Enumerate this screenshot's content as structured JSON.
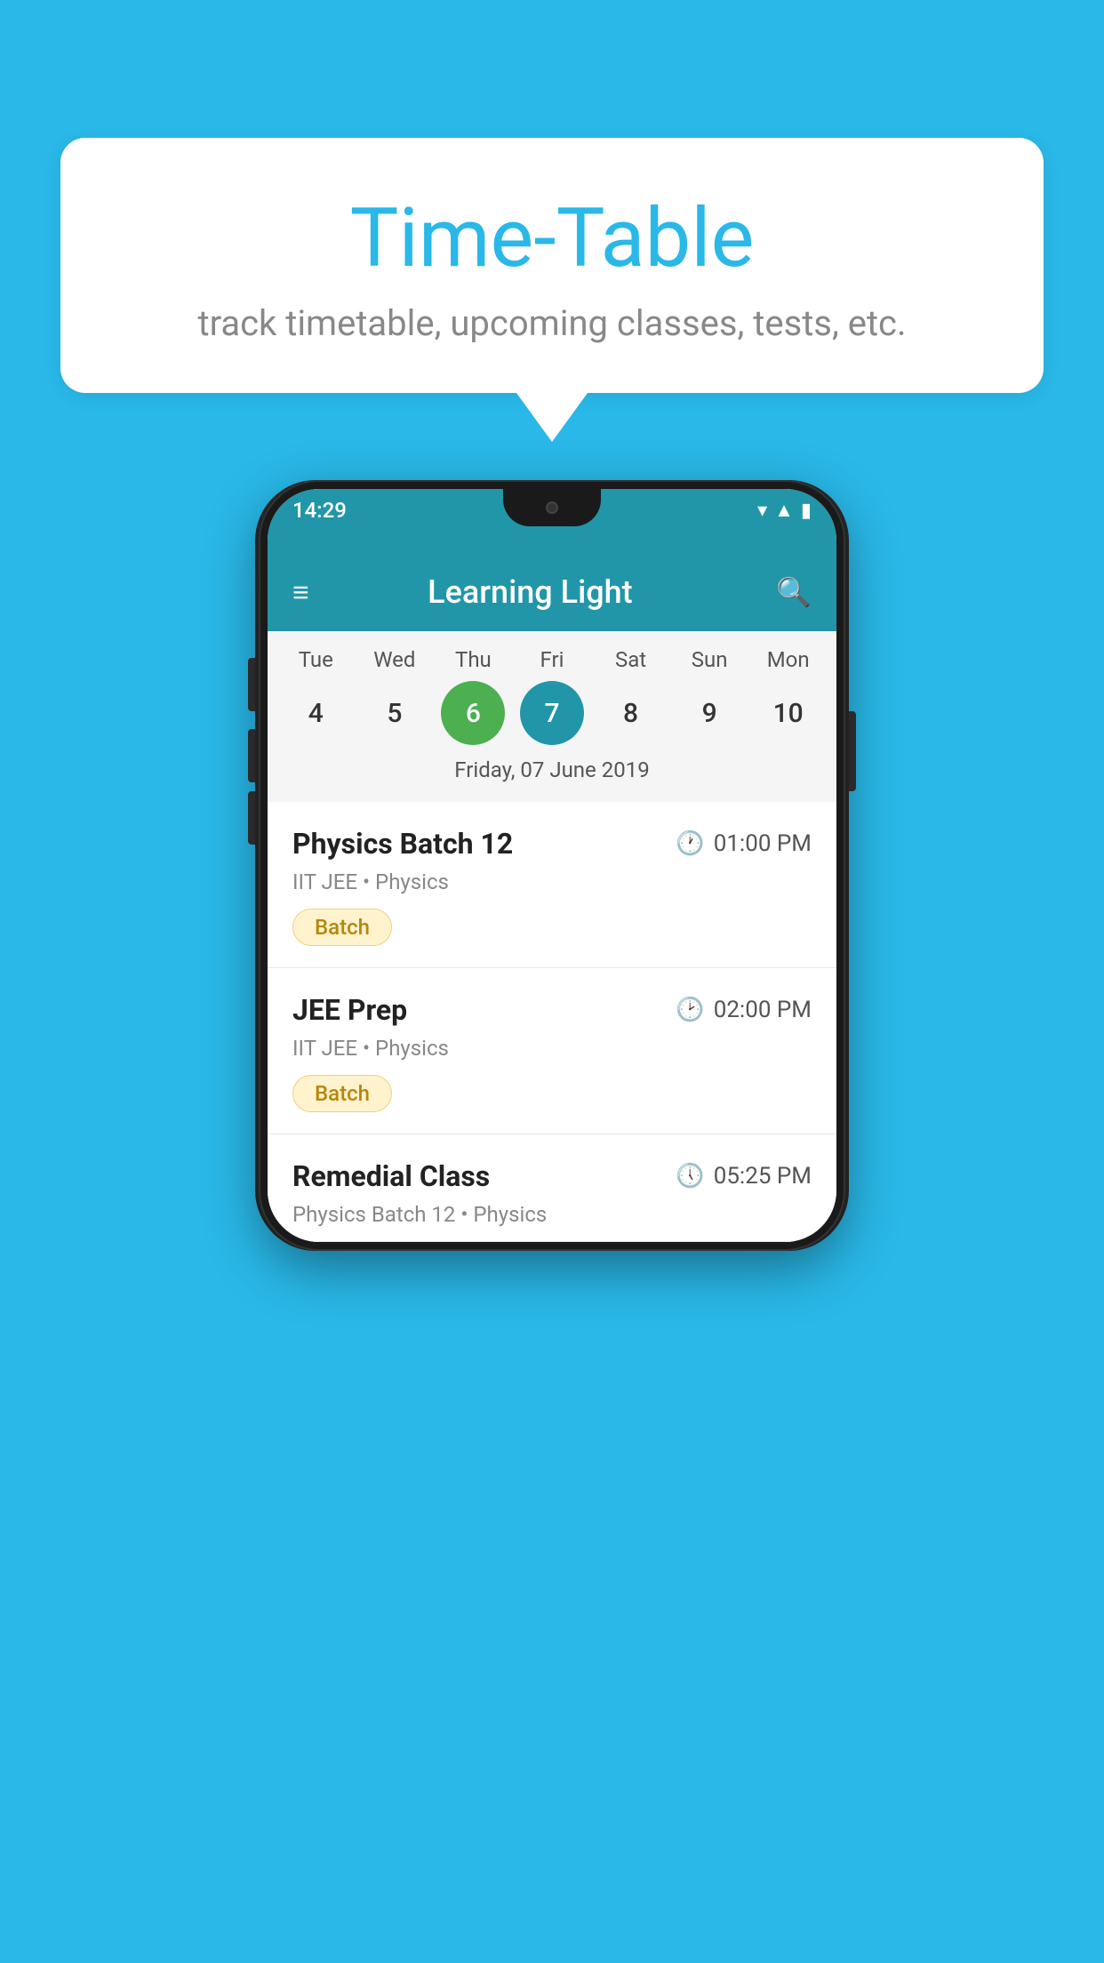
{
  "background_color": "#29b8e8",
  "speech_bubble": {
    "title": "Time-Table",
    "subtitle": "track timetable, upcoming classes, tests, etc."
  },
  "phone": {
    "status_bar": {
      "time": "14:29"
    },
    "app_bar": {
      "title": "Learning Light"
    },
    "calendar": {
      "days": [
        "Tue",
        "Wed",
        "Thu",
        "Fri",
        "Sat",
        "Sun",
        "Mon"
      ],
      "dates": [
        "4",
        "5",
        "6",
        "7",
        "8",
        "9",
        "10"
      ],
      "today_index": 2,
      "selected_index": 3,
      "selected_label": "Friday, 07 June 2019"
    },
    "schedule": [
      {
        "title": "Physics Batch 12",
        "time": "01:00 PM",
        "subtitle": "IIT JEE • Physics",
        "badge": "Batch"
      },
      {
        "title": "JEE Prep",
        "time": "02:00 PM",
        "subtitle": "IIT JEE • Physics",
        "badge": "Batch"
      },
      {
        "title": "Remedial Class",
        "time": "05:25 PM",
        "subtitle": "Physics Batch 12 • Physics",
        "badge": null
      }
    ]
  }
}
